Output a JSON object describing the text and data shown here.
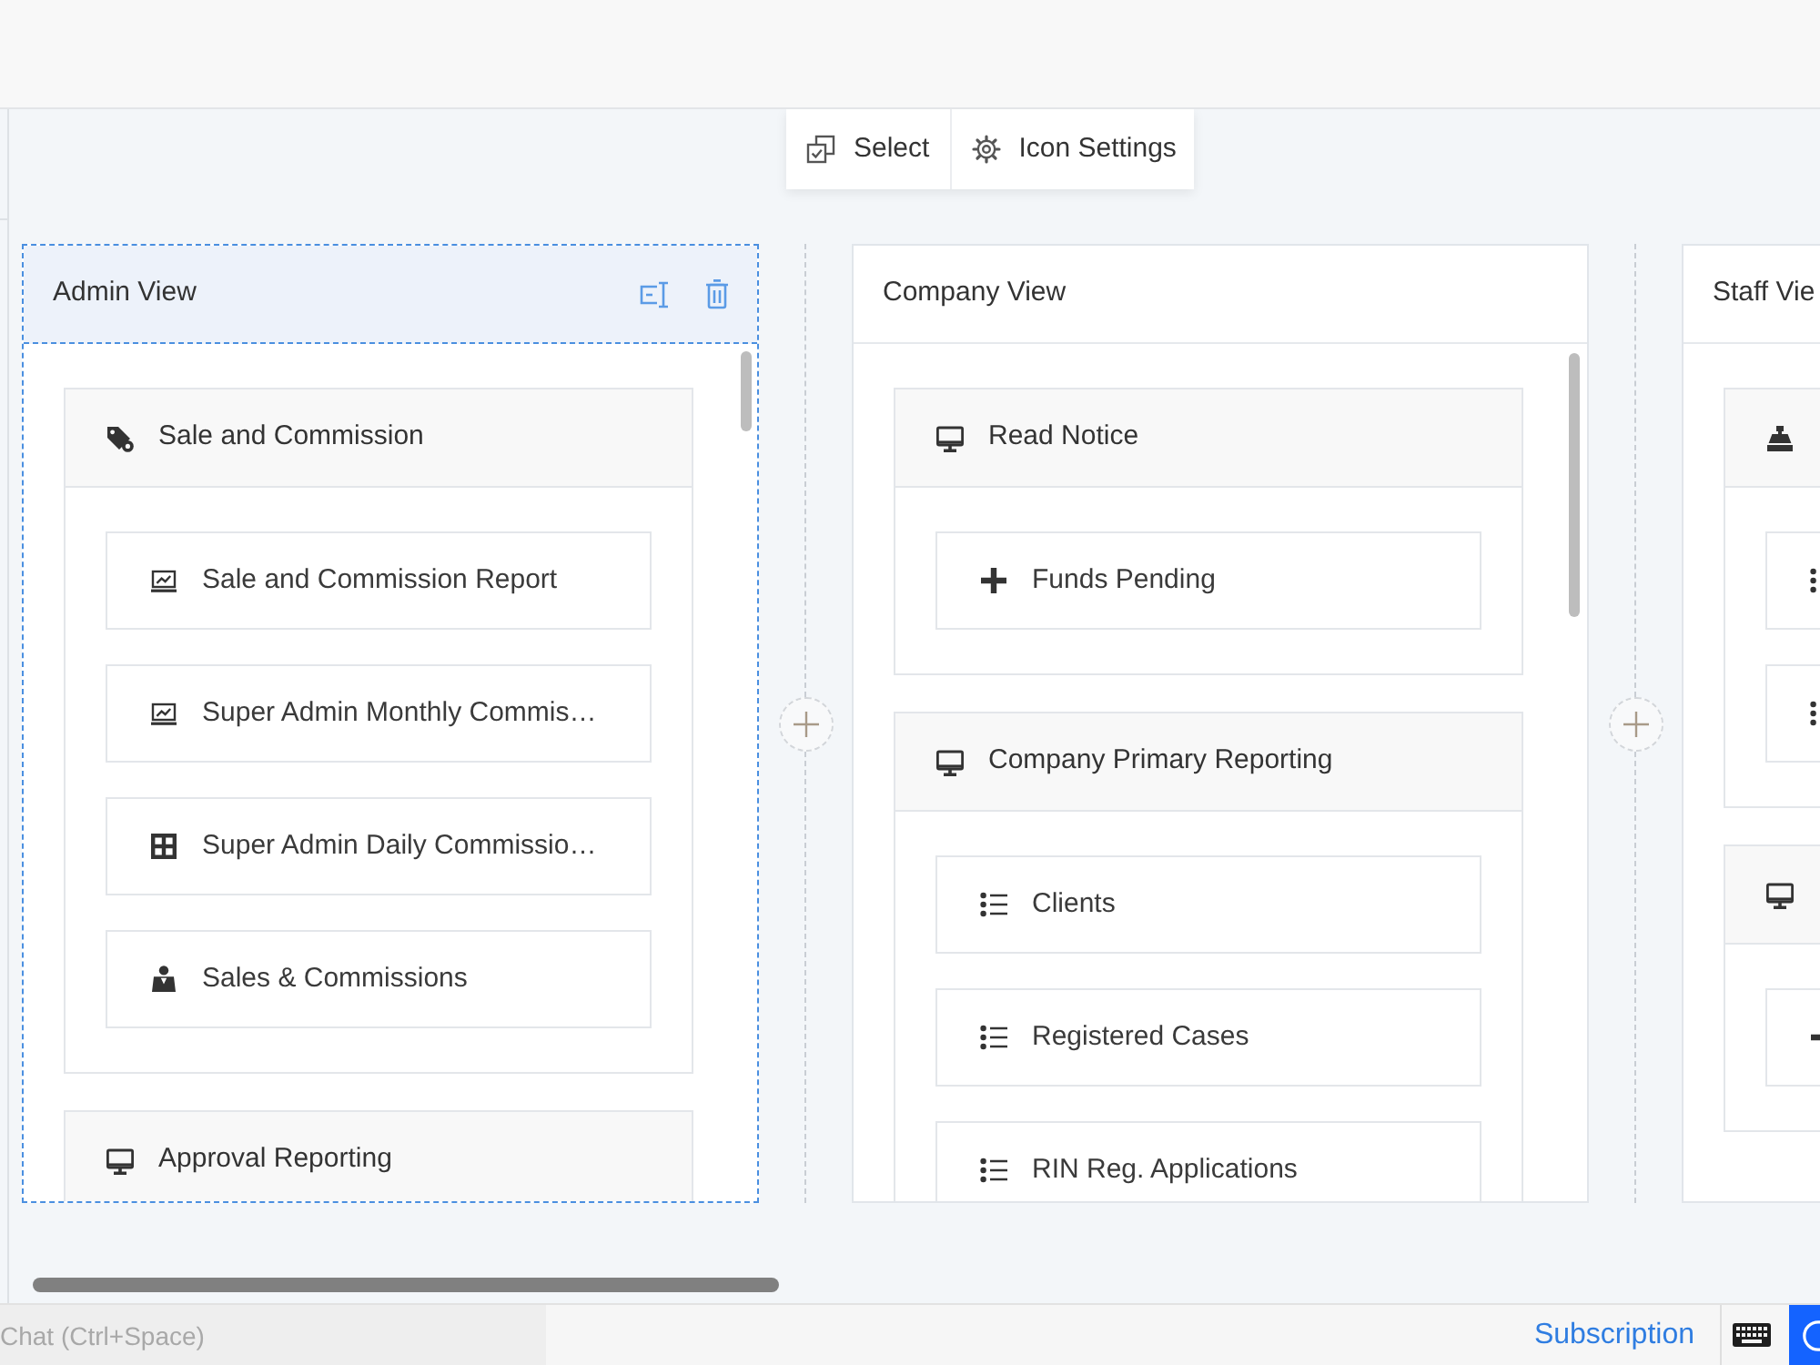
{
  "toolbar": [
    {
      "label": "Select",
      "kind": "select"
    },
    {
      "label": "Icon Settings",
      "kind": "settings"
    }
  ],
  "columns": [
    {
      "title": "Admin View",
      "selected": true,
      "sections": [
        {
          "title": "Sale and Commission",
          "kind": "tag",
          "items": [
            {
              "label": "Sale and Commission Report",
              "kind": "chart"
            },
            {
              "label": "Super Admin Monthly Commis…",
              "kind": "chart"
            },
            {
              "label": "Super Admin Daily Commissio…",
              "kind": "grid"
            },
            {
              "label": "Sales & Commissions",
              "kind": "person"
            }
          ]
        },
        {
          "title": "Approval Reporting",
          "kind": "monitor"
        }
      ]
    },
    {
      "title": "Company View",
      "selected": false,
      "sections": [
        {
          "title": "Read Notice",
          "kind": "monitor",
          "items": [
            {
              "label": "Funds Pending",
              "kind": "plus"
            }
          ]
        },
        {
          "title": "Company Primary Reporting",
          "kind": "monitor",
          "items": [
            {
              "label": "Clients",
              "kind": "list"
            },
            {
              "label": "Registered Cases",
              "kind": "list"
            },
            {
              "label": "RIN Reg. Applications",
              "kind": "list"
            }
          ]
        }
      ]
    },
    {
      "title": "Staff Vie",
      "selected": false,
      "sections": [
        {
          "kind": "register",
          "items": [
            {
              "kind": "list"
            },
            {
              "kind": "list"
            }
          ]
        },
        {
          "kind": "monitor",
          "items": [
            {
              "kind": "plus"
            }
          ]
        }
      ]
    }
  ],
  "status_bar": {
    "chat": {
      "placeholder": "Chat (Ctrl+Space)"
    },
    "link": "Subscription"
  }
}
